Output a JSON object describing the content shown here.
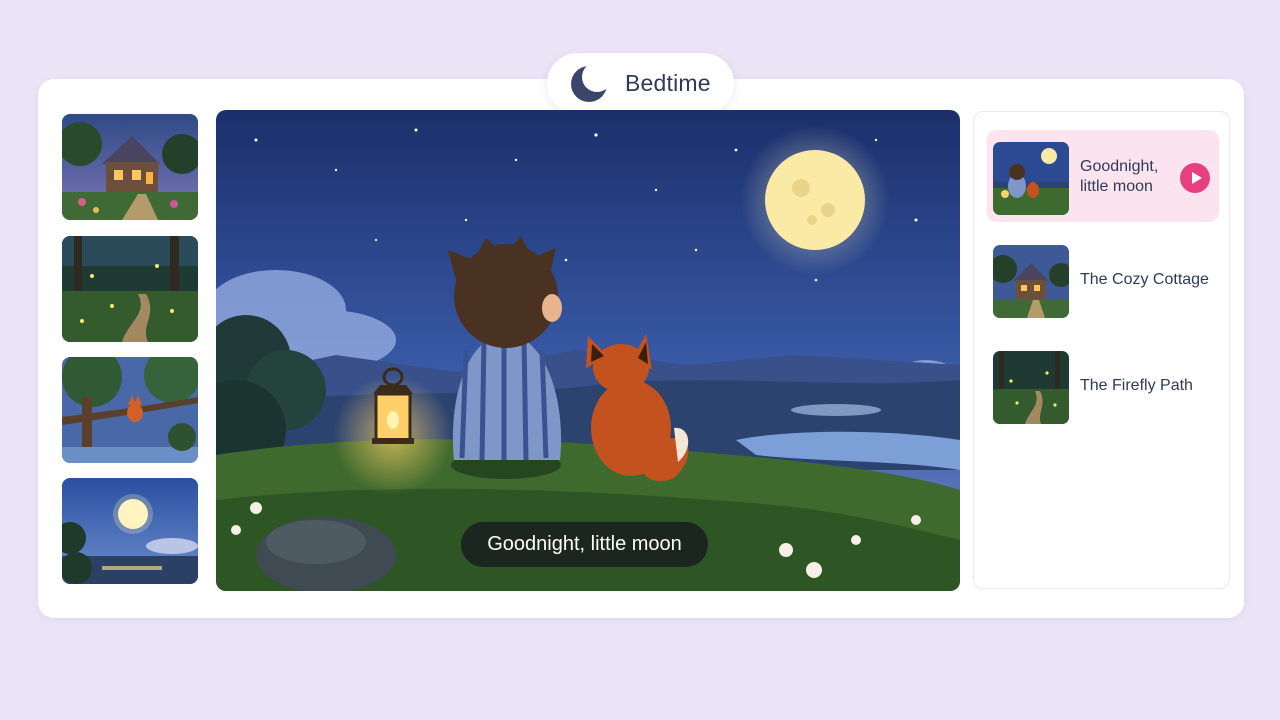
{
  "header": {
    "title": "Bedtime",
    "icon": "moon-icon"
  },
  "main": {
    "caption": "Goodnight, little moon"
  },
  "thumbnails": [
    {
      "name": "cottage-thumbnail"
    },
    {
      "name": "firefly-path-thumbnail"
    },
    {
      "name": "fox-in-tree-thumbnail"
    },
    {
      "name": "full-moon-thumbnail"
    }
  ],
  "playlist": {
    "items": [
      {
        "label": "Goodnight, little moon",
        "active": true
      },
      {
        "label": "The Cozy Cottage",
        "active": false
      },
      {
        "label": "The Firefly Path",
        "active": false
      }
    ]
  },
  "colors": {
    "background": "#ebe4f6",
    "accent": "#e83f80",
    "active_row": "#fbe4ee",
    "text": "#2f3a5a"
  }
}
